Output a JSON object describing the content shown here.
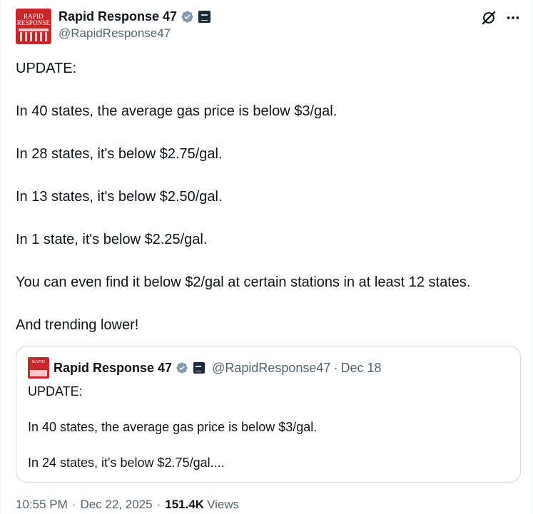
{
  "author": {
    "display_name": "Rapid Response 47",
    "handle": "@RapidResponse47",
    "avatar_text_line1": "RAPID",
    "avatar_text_line2": "RESPONSE"
  },
  "tweet": {
    "paragraphs": [
      "UPDATE:",
      "In 40 states, the average gas price is below $3/gal.",
      "In 28 states, it's below $2.75/gal.",
      "In 13 states, it's below $2.50/gal.",
      "In 1 state, it's below $2.25/gal.",
      "You can even find it below $2/gal at certain stations in at least 12 states.",
      "And trending lower!"
    ]
  },
  "quoted_tweet": {
    "display_name": "Rapid Response 47",
    "handle": "@RapidResponse47",
    "separator": "·",
    "date": "Dec 18",
    "paragraphs": [
      "UPDATE:",
      "In 40 states, the average gas price is below $3/gal.",
      "In 24 states, it's below $2.75/gal...."
    ]
  },
  "meta": {
    "time": "10:55 PM",
    "separator": "·",
    "date": "Dec 22, 2025",
    "views_count": "151.4K",
    "views_label": "Views"
  },
  "icons": {
    "verified": "verified-badge-icon",
    "affiliation": "white-house-badge-icon",
    "grok": "grok-icon",
    "more": "more-icon"
  },
  "colors": {
    "verified_blue": "#829aab",
    "text_primary": "#0f1419",
    "text_secondary": "#536471",
    "border": "#cfd9de",
    "avatar_red": "#c62828"
  }
}
